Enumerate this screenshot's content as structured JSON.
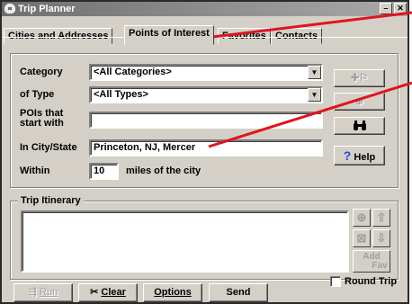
{
  "window": {
    "title": "Trip Planner",
    "min_icon": "–",
    "max_icon": "□",
    "close_icon": "✕"
  },
  "tabs": [
    {
      "label": "Cities and Addresses",
      "active": false
    },
    {
      "label": "Points of Interest",
      "active": true
    },
    {
      "label": "Favorites",
      "active": false
    },
    {
      "label": "Contacts",
      "active": false
    }
  ],
  "form": {
    "category": {
      "label": "Category",
      "value": "<All Categories>"
    },
    "type": {
      "label": "of Type",
      "value": "<All Types>"
    },
    "pois": {
      "label_line1": "POIs that",
      "label_line2": "start with",
      "value": ""
    },
    "city": {
      "label": "In City/State",
      "value": "Princeton, NJ, Mercer"
    },
    "within": {
      "label": "Within",
      "value": "10",
      "suffix": "miles of the city"
    }
  },
  "side_buttons": {
    "find_icon": "binoculars-icon",
    "help_label": "Help"
  },
  "itinerary": {
    "label": "Trip Itinerary",
    "add_fav_label_1": "Add",
    "add_fav_label_2": "Fav"
  },
  "bottom": {
    "run_label": "Run",
    "clear_label": "Clear",
    "options_label": "Options",
    "send_label": "Send",
    "round_trip_label": "Round Trip"
  },
  "annotation_color": "#e0141e"
}
